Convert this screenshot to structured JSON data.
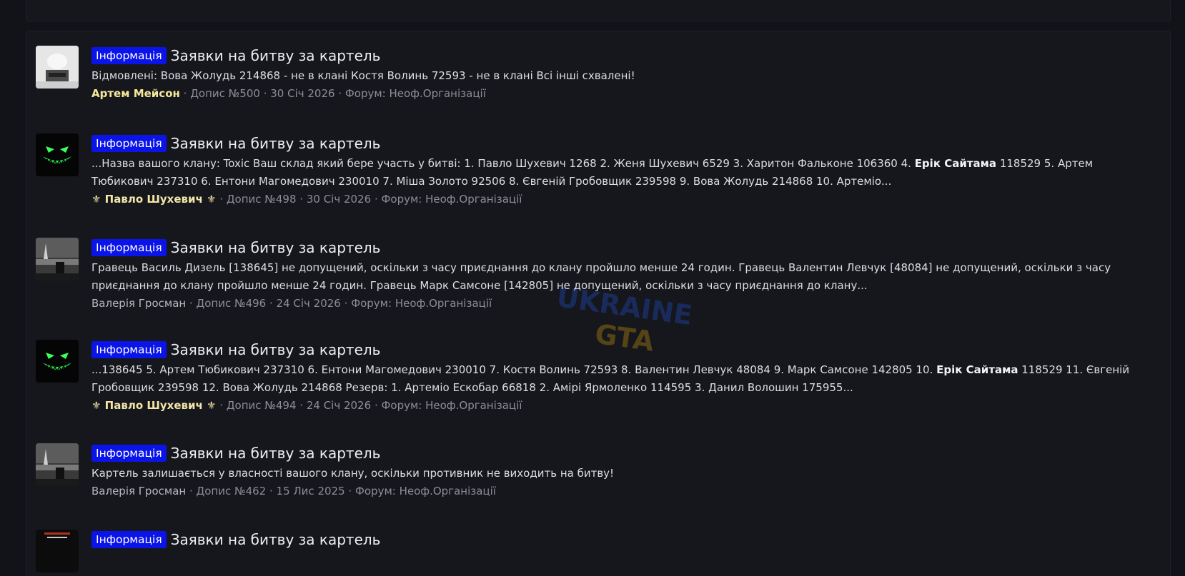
{
  "watermark": {
    "line1": "UKRAINE",
    "line2": "GTA"
  },
  "results": [
    {
      "avatar": "cat-photo-avatar",
      "prefix": "Інформація",
      "title": "Заявки на битву за картель",
      "snippet_parts": [
        {
          "text": "Відмовлені: Вова Жолудь 214868 - не в клані Костя Волинь 72593 - не в клані Всі інші схвалені!",
          "bold": false
        }
      ],
      "author": "Артем Мейсон",
      "author_style": "gold2",
      "post": "Допис №500",
      "date": "30 Січ 2026",
      "forum": "Форум: Неоф.Організації"
    },
    {
      "avatar": "green-grin-avatar",
      "prefix": "Інформація",
      "title": "Заявки на битву за картель",
      "snippet_parts": [
        {
          "text": "...Назва вашого клану: Toxic Ваш склад який бере участь у битві: 1. Павло Шухевич 1268 2. Женя Шухевич 6529 3. Харитон Фальконе 106360 4. ",
          "bold": false
        },
        {
          "text": "Ерік Сайтама",
          "bold": true
        },
        {
          "text": " 118529 5. Артем Тюбикович 237310 6. Ентони Магомедович 230010 7. Міша Золото 92506 8. Євгеній Гробовщик 239598 9. Вова Жолудь 214868 10. Артеміо...",
          "bold": false
        }
      ],
      "author": "⚜ Павло Шухевич ⚜",
      "author_style": "gold",
      "post": "Допис №498",
      "date": "30 Січ 2026",
      "forum": "Форум: Неоф.Організації"
    },
    {
      "avatar": "city-night-avatar",
      "prefix": "Інформація",
      "title": "Заявки на битву за картель",
      "snippet_parts": [
        {
          "text": "Гравець Василь Дизель [138645] не допущений, оскільки з часу приєднання до клану пройшло менше 24 годин. Гравець Валентин Левчук [48084] не допущений, оскільки з часу приєднання до клану пройшло менше 24 годин. Гравець Марк Самсоне [142805] не допущений, оскільки з часу приєднання до клану...",
          "bold": false
        }
      ],
      "author": "Валерія Гросман",
      "author_style": "plain",
      "post": "Допис №496",
      "date": "24 Січ 2026",
      "forum": "Форум: Неоф.Організації"
    },
    {
      "avatar": "green-grin-avatar",
      "prefix": "Інформація",
      "title": "Заявки на битву за картель",
      "snippet_parts": [
        {
          "text": "...138645 5. Артем Тюбикович 237310 6. Ентони Магомедович 230010 7. Костя Волинь 72593 8. Валентин Левчук 48084 9. Марк Самсоне 142805 10. ",
          "bold": false
        },
        {
          "text": "Ерік Сайтама",
          "bold": true
        },
        {
          "text": " 118529 11. Євгеній Гробовщик 239598 12. Вова Жолудь 214868 Резерв: 1. Артеміо Ескобар 66818 2. Амірі Ярмоленко 114595 3. Данил Волошин 175955...",
          "bold": false
        }
      ],
      "author": "⚜ Павло Шухевич ⚜",
      "author_style": "gold",
      "post": "Допис №494",
      "date": "24 Січ 2026",
      "forum": "Форум: Неоф.Організації"
    },
    {
      "avatar": "city-night-avatar",
      "prefix": "Інформація",
      "title": "Заявки на битву за картель",
      "snippet_parts": [
        {
          "text": "Картель залишається у власності вашого клану, оскільки противник не виходить на битву!",
          "bold": false
        }
      ],
      "author": "Валерія Гросман",
      "author_style": "plain",
      "post": "Допис №462",
      "date": "15 Лис 2025",
      "forum": "Форум: Неоф.Організації"
    },
    {
      "avatar": "poster-avatar",
      "prefix": "Інформація",
      "title": "Заявки на битву за картель",
      "snippet_parts": [],
      "author": "",
      "author_style": "plain",
      "post": "",
      "date": "",
      "forum": ""
    }
  ]
}
